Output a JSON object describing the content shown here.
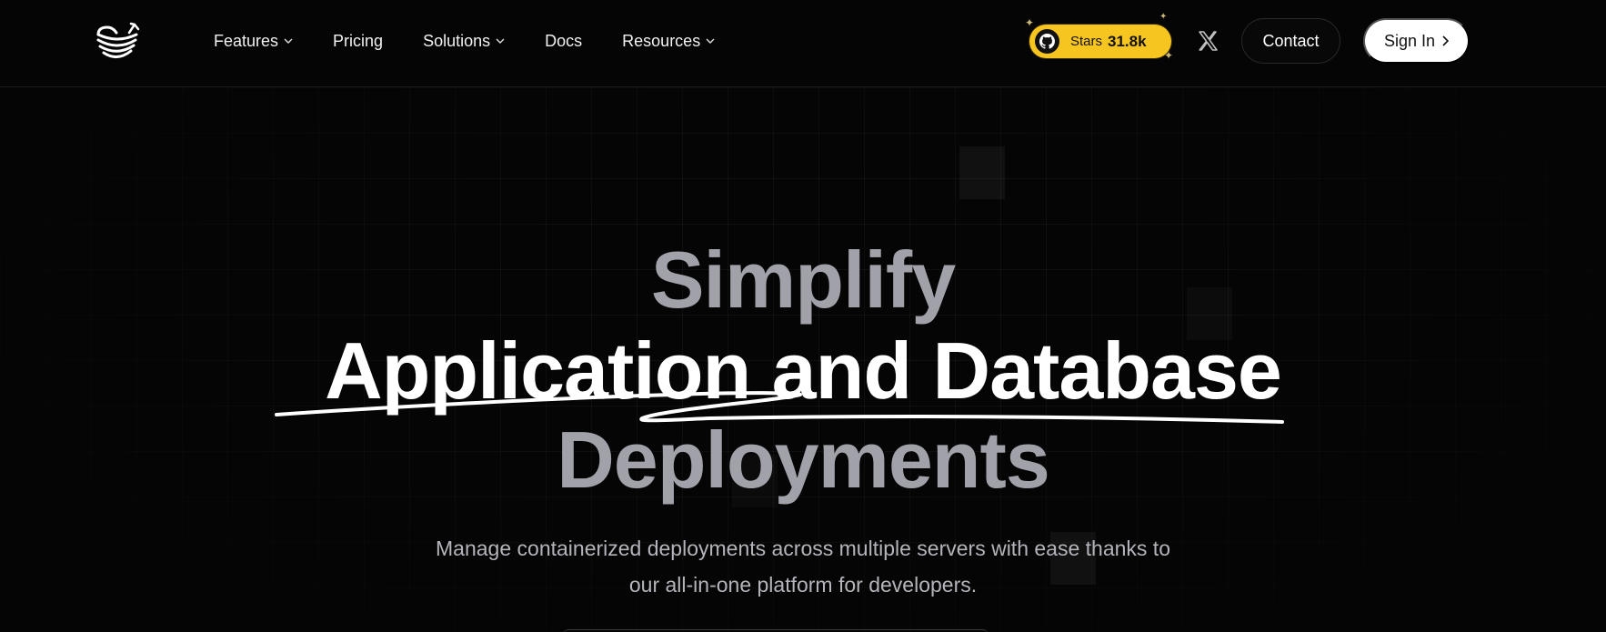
{
  "header": {
    "nav": [
      {
        "label": "Features",
        "has_dropdown": true
      },
      {
        "label": "Pricing",
        "has_dropdown": false
      },
      {
        "label": "Solutions",
        "has_dropdown": true
      },
      {
        "label": "Docs",
        "has_dropdown": false
      },
      {
        "label": "Resources",
        "has_dropdown": true
      }
    ],
    "github": {
      "label": "Stars",
      "count": "31.8k",
      "icon": "github-icon"
    },
    "social_icon": "x-icon",
    "contact_label": "Contact",
    "signin_label": "Sign In"
  },
  "hero": {
    "line1": "Simplify",
    "line2": "Application and Database",
    "line3": "Deployments",
    "subtitle_line1": "Manage containerized deployments across multiple servers with ease thanks to",
    "subtitle_line2": "our all-in-one platform for developers."
  },
  "colors": {
    "background": "#050505",
    "accent_yellow": "#f7c520",
    "muted_heading": "#a1a1aa",
    "subtitle": "#b4b4bb"
  }
}
